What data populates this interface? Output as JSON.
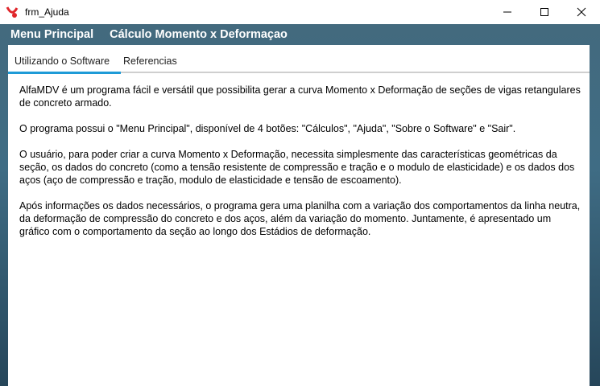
{
  "window": {
    "title": "frm_Ajuda",
    "icons": {
      "app": "alfamdv-logo-icon",
      "minimize": "minimize-icon",
      "maximize": "maximize-icon",
      "close": "close-icon"
    }
  },
  "menu": {
    "items": [
      {
        "label": "Menu Principal"
      },
      {
        "label": "Cálculo Momento x Deformaçao"
      }
    ]
  },
  "tabs": [
    {
      "label": "Utilizando o Software",
      "active": true
    },
    {
      "label": "Referencias",
      "active": false
    }
  ],
  "content": {
    "paragraphs": [
      "AlfaMDV é um programa fácil e versátil que possibilita gerar a curva Momento x Deformação de seções de vigas retangulares de concreto armado.",
      "O programa possui o \"Menu Principal\", disponível de 4 botões: \"Cálculos\", \"Ajuda\", \"Sobre o Software\" e \"Sair\".",
      "O usuário, para poder criar a curva Momento x Deformação, necessita simplesmente das características geométricas da seção, os dados do concreto (como a tensão resistente de compressão e tração e o modulo de elasticidade) e os dados dos aços (aço de compressão e tração, modulo de elasticidade e tensão de escoamento).",
      "Após informações os dados necessários, o programa gera uma planilha com a variação dos comportamentos da linha neutra, da deformação de compressão do concreto e dos aços, além da variação do momento. Juntamente, é apresentado um gráfico com o comportamento da seção ao longo dos Estádios de deformação."
    ]
  },
  "colors": {
    "menu_background": "#3f6c84",
    "tab_active_indicator": "#1e9bd7",
    "logo_red": "#e0262b"
  }
}
